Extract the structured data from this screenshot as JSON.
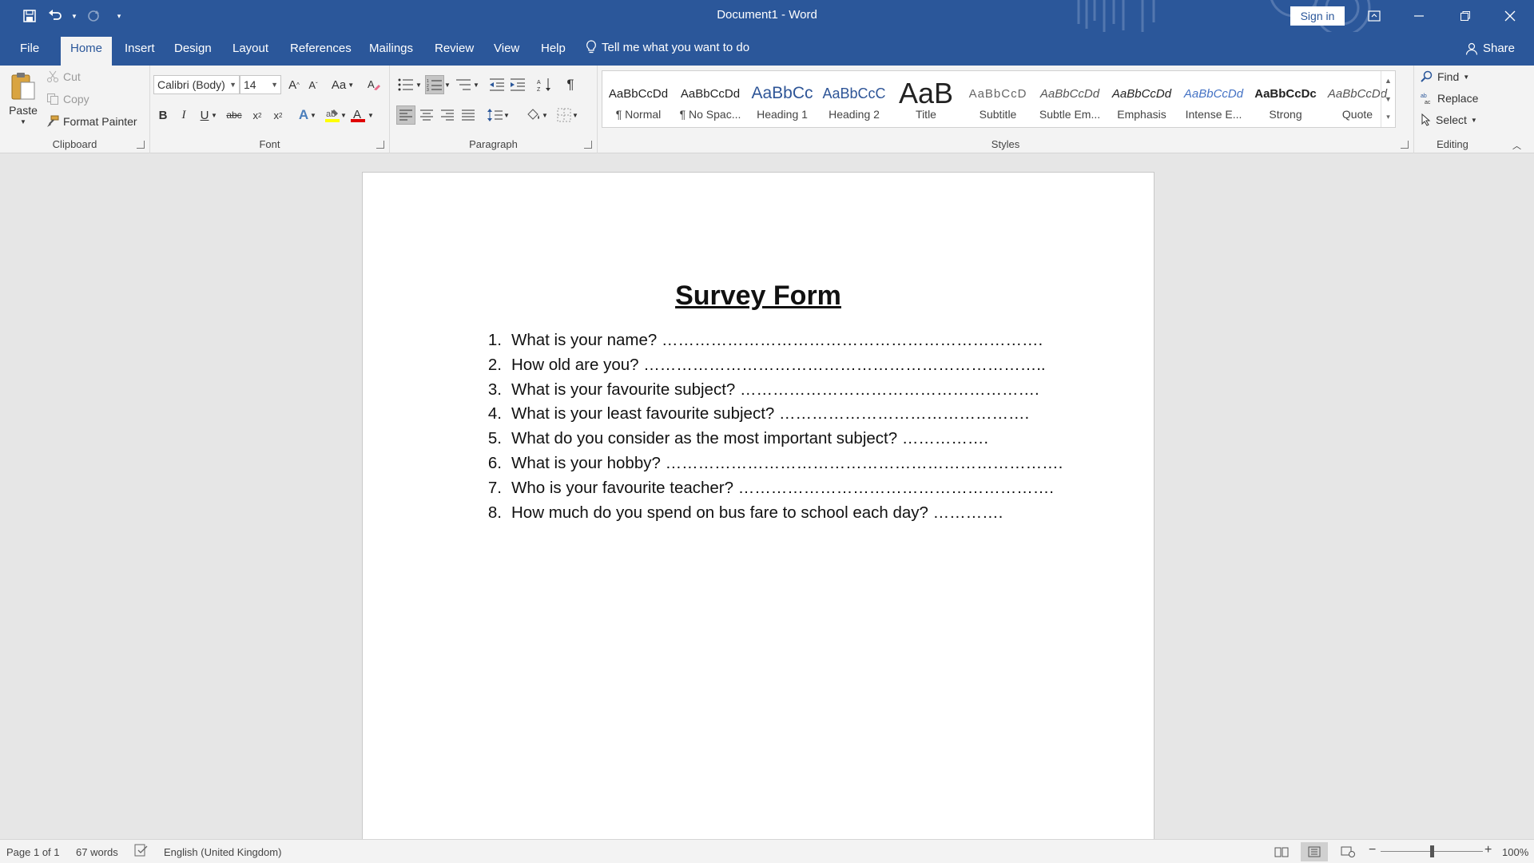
{
  "title_bar": {
    "doc_title": "Document1  -  Word",
    "sign_in": "Sign in"
  },
  "tabs": [
    "File",
    "Home",
    "Insert",
    "Design",
    "Layout",
    "References",
    "Mailings",
    "Review",
    "View",
    "Help"
  ],
  "active_tab": "Home",
  "tell_me": "Tell me what you want to do",
  "share": "Share",
  "ribbon": {
    "clipboard": {
      "label": "Clipboard",
      "paste": "Paste",
      "cut": "Cut",
      "copy": "Copy",
      "format_painter": "Format Painter"
    },
    "font": {
      "label": "Font",
      "font_name": "Calibri (Body)",
      "font_size": "14",
      "case_label": "Aa"
    },
    "paragraph": {
      "label": "Paragraph"
    },
    "styles": {
      "label": "Styles",
      "items": [
        {
          "sample": "AaBbCcDd",
          "name": "¶ Normal"
        },
        {
          "sample": "AaBbCcDd",
          "name": "¶ No Spac..."
        },
        {
          "sample": "AaBbCc",
          "name": "Heading 1"
        },
        {
          "sample": "AaBbCcC",
          "name": "Heading 2"
        },
        {
          "sample": "AaB",
          "name": "Title"
        },
        {
          "sample": "AaBbCcD",
          "name": "Subtitle"
        },
        {
          "sample": "AaBbCcDd",
          "name": "Subtle Em..."
        },
        {
          "sample": "AaBbCcDd",
          "name": "Emphasis"
        },
        {
          "sample": "AaBbCcDd",
          "name": "Intense E..."
        },
        {
          "sample": "AaBbCcDc",
          "name": "Strong"
        },
        {
          "sample": "AaBbCcDd",
          "name": "Quote"
        }
      ]
    },
    "editing": {
      "label": "Editing",
      "find": "Find",
      "replace": "Replace",
      "select": "Select"
    }
  },
  "document": {
    "heading": "Survey Form",
    "questions": [
      {
        "num": "1.",
        "text": "What is your name? ……………………………………………………………."
      },
      {
        "num": "2.",
        "text": "How old are you? ……………………………………………………………….."
      },
      {
        "num": "3.",
        "text": "What is your favourite subject? ………………………………………………."
      },
      {
        "num": "4.",
        "text": "What is your least favourite subject? ………………………………………."
      },
      {
        "num": "5.",
        "text": "What do you consider as the most important subject? ……………."
      },
      {
        "num": "6.",
        "text": "What is your hobby? ………………………………………………………………."
      },
      {
        "num": "7.",
        "text": "Who is your favourite teacher? …………………………………………………."
      },
      {
        "num": "8.",
        "text": "How much do you spend on bus fare to school each day? …………."
      }
    ]
  },
  "status_bar": {
    "page": "Page 1 of 1",
    "words": "67 words",
    "language": "English (United Kingdom)",
    "zoom": "100%"
  },
  "colors": {
    "brand": "#2b579a",
    "ribbon": "#f3f3f3",
    "canvas": "#e6e6e6",
    "font_color_red": "#e00000",
    "highlight_yellow": "#ffff00"
  }
}
